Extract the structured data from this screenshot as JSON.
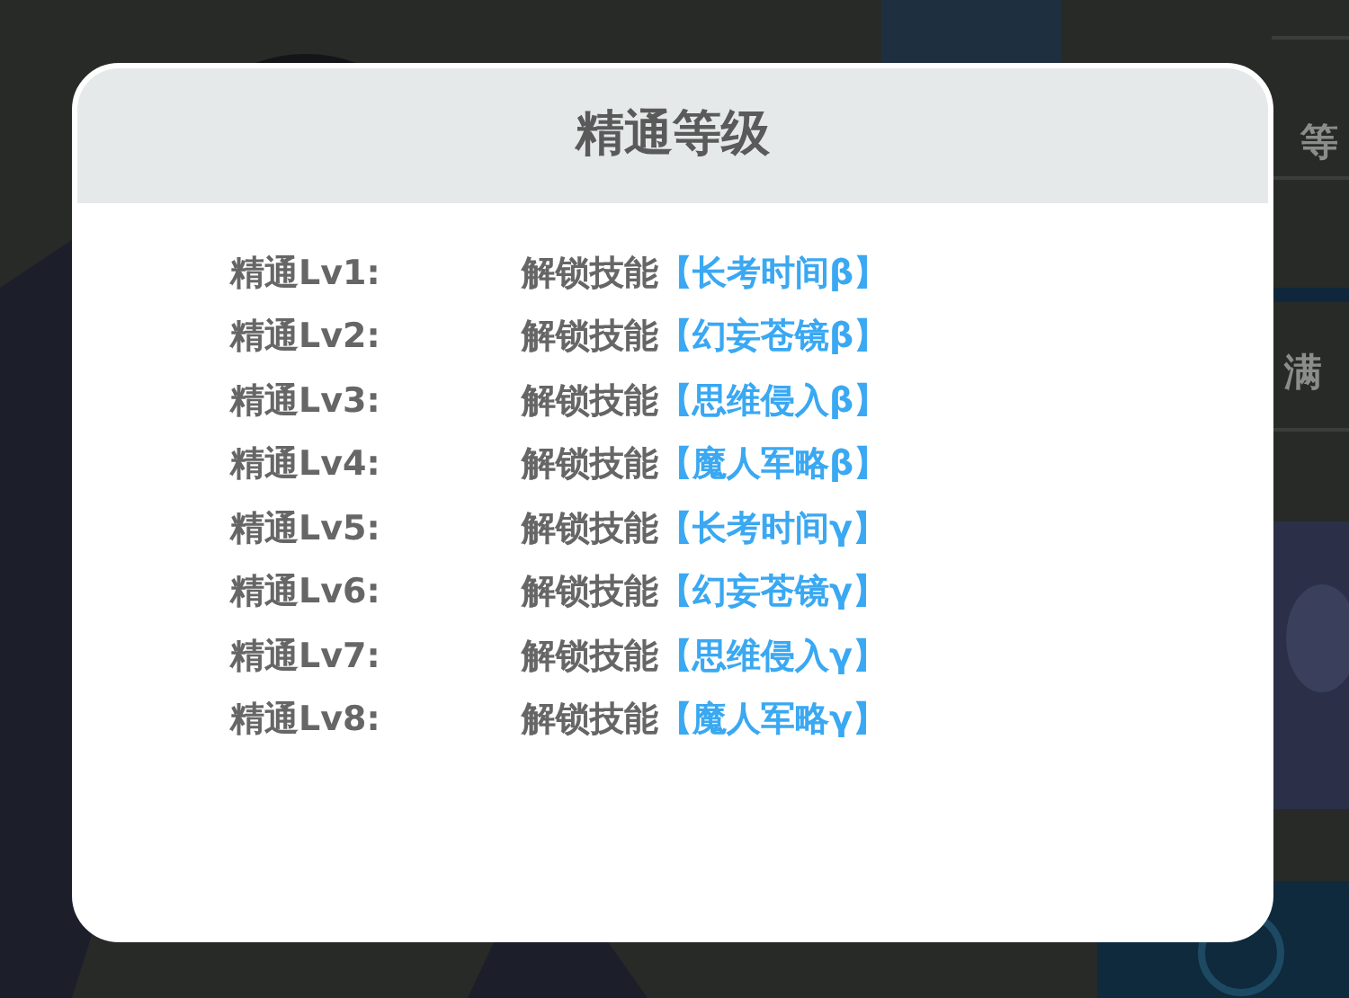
{
  "background": {
    "kind": "picture",
    "texts": [
      "等",
      "满"
    ]
  },
  "dialog": {
    "title": "精通等级",
    "rows": [
      {
        "level": "精通Lv1:",
        "action": "解锁技能",
        "skill": "【长考时间β】"
      },
      {
        "level": "精通Lv2:",
        "action": "解锁技能",
        "skill": "【幻妄苍镜β】"
      },
      {
        "level": "精通Lv3:",
        "action": "解锁技能",
        "skill": "【思维侵入β】"
      },
      {
        "level": "精通Lv4:",
        "action": "解锁技能",
        "skill": "【魔人军略β】"
      },
      {
        "level": "精通Lv5:",
        "action": "解锁技能",
        "skill": "【长考时间γ】"
      },
      {
        "level": "精通Lv6:",
        "action": "解锁技能",
        "skill": "【幻妄苍镜γ】"
      },
      {
        "level": "精通Lv7:",
        "action": "解锁技能",
        "skill": "【思维侵入γ】"
      },
      {
        "level": "精通Lv8:",
        "action": "解锁技能",
        "skill": "【魔人军略γ】"
      }
    ]
  }
}
